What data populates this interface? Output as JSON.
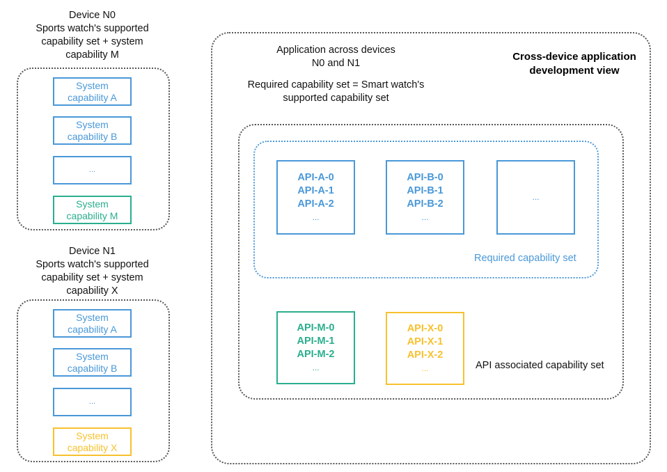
{
  "devices": [
    {
      "caption": "Device N0\nSports watch's supported\ncapability set + system\ncapability M",
      "capabilities": [
        {
          "label": "System\ncapability A",
          "color": "#4a98d8"
        },
        {
          "label": "System\ncapability B",
          "color": "#4a98d8"
        },
        {
          "label": "...",
          "color": "#4a98d8"
        },
        {
          "label": "System\ncapability M",
          "color": "#2aae8e"
        }
      ]
    },
    {
      "caption": "Device N1\nSports watch's supported\ncapability set + system\ncapability X",
      "capabilities": [
        {
          "label": "System\ncapability A",
          "color": "#4a98d8"
        },
        {
          "label": "System\ncapability B",
          "color": "#4a98d8"
        },
        {
          "label": "...",
          "color": "#4a98d8"
        },
        {
          "label": "System\ncapability X",
          "color": "#f7c12e"
        }
      ]
    }
  ],
  "app_view": {
    "title": "Cross-device application\ndevelopment view",
    "app_caption": "Application across devices\nN0 and N1",
    "required_caption": "Required capability set = Smart watch's\nsupported capability set",
    "required_set": {
      "label": "Required capability set",
      "boxes": [
        {
          "lines": [
            "API-A-0",
            "API-A-1",
            "API-A-2"
          ],
          "ellipsis": "..."
        },
        {
          "lines": [
            "API-B-0",
            "API-B-1",
            "API-B-2"
          ],
          "ellipsis": "..."
        },
        {
          "lines": [],
          "ellipsis": "..."
        }
      ]
    },
    "associated_set": {
      "label": "API associated capability set",
      "boxes": [
        {
          "lines": [
            "API-M-0",
            "API-M-1",
            "API-M-2"
          ],
          "ellipsis": "..."
        },
        {
          "lines": [
            "API-X-0",
            "API-X-1",
            "API-X-2"
          ],
          "ellipsis": "..."
        }
      ]
    }
  },
  "colors": {
    "blue": "#4a98d8",
    "teal": "#2aae8e",
    "yellow": "#f7c12e",
    "dotted_border": "#555555"
  }
}
